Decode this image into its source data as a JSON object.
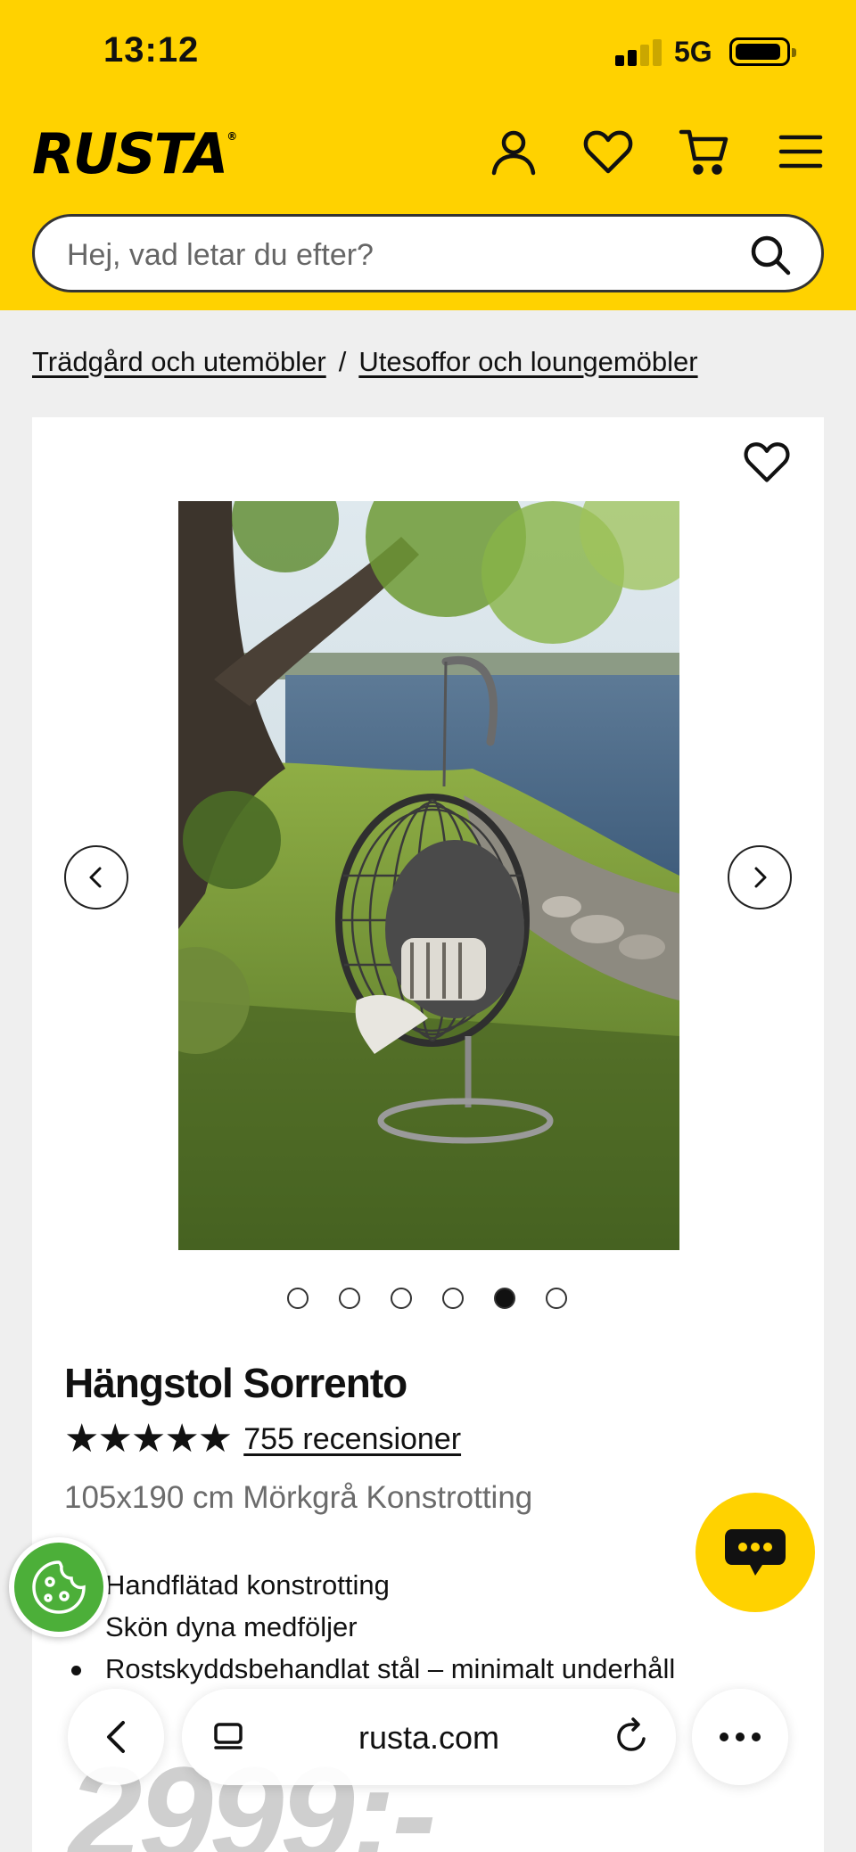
{
  "status_bar": {
    "time": "13:12",
    "network": "5G"
  },
  "header": {
    "logo": "RUSTA",
    "logo_mark": "®",
    "icons": [
      "account-icon",
      "heart-icon",
      "cart-icon",
      "menu-icon"
    ],
    "search_placeholder": "Hej, vad letar du efter?"
  },
  "breadcrumb": {
    "items": [
      "Trädgård och utemöbler",
      "Utesoffor och loungemöbler"
    ],
    "separator": "/"
  },
  "product": {
    "title": "Hängstol Sorrento",
    "stars": "★★★★★",
    "rating_stars": 5,
    "reviews": "755 recensioner",
    "variant": "105x190 cm Mörkgrå Konstrotting",
    "features": [
      "Handflätad konstrotting",
      "Skön dyna medföljer",
      "Rostskyddsbehandlat stål – minimalt underhåll"
    ],
    "price": "2999:-",
    "carousel_total": 6,
    "carousel_active": 5
  },
  "browser": {
    "url": "rusta.com"
  },
  "colors": {
    "brand_yellow": "#ffd200",
    "cookie_green": "#4caf39",
    "text": "#111111"
  }
}
